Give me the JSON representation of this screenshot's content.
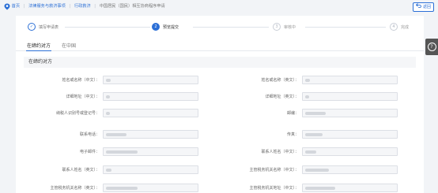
{
  "breadcrumb": {
    "home": "首页",
    "items": [
      "法律服务与救济事项",
      "行政救济"
    ],
    "current": "中国居民（国民）相互协商程序申请"
  },
  "header": {
    "back_label": "返回"
  },
  "steps": [
    {
      "num": "✓",
      "label": "填写申请表",
      "state": "done"
    },
    {
      "num": "2",
      "label": "预览提交",
      "state": "active"
    },
    {
      "num": "3",
      "label": "审核中",
      "state": "todo"
    },
    {
      "num": "4",
      "label": "完成",
      "state": "todo"
    }
  ],
  "tabs": [
    {
      "label": "在缔约对方",
      "active": true
    },
    {
      "label": "在中国",
      "active": false
    }
  ],
  "section": {
    "title": "在缔约对方"
  },
  "form_rows": [
    {
      "left_label": "姓名或名称（中文）：",
      "right_label": "姓名或名称（英文）："
    },
    {
      "left_label": "详细地址（中文）：",
      "right_label": "详细地址（英文）："
    },
    {
      "left_label": "纳税人识别号或登记号：",
      "right_label": "邮编："
    },
    {
      "left_label": "联系电话：",
      "right_label": "传真："
    },
    {
      "left_label": "电子邮件：",
      "right_label": "联系人姓名（中文）："
    },
    {
      "left_label": "联系人姓名（英文）：",
      "right_label": "主管税务机关名称（中文）："
    },
    {
      "left_label": "主管税务机关名称（英文）：",
      "right_label": "主管税务机关地址（中文）："
    }
  ],
  "icons": {
    "home": "home-icon",
    "back": "back-arrow-icon",
    "help": "question-icon"
  },
  "colors": {
    "accent": "#2b6fd6",
    "side_panel": "#555555"
  }
}
